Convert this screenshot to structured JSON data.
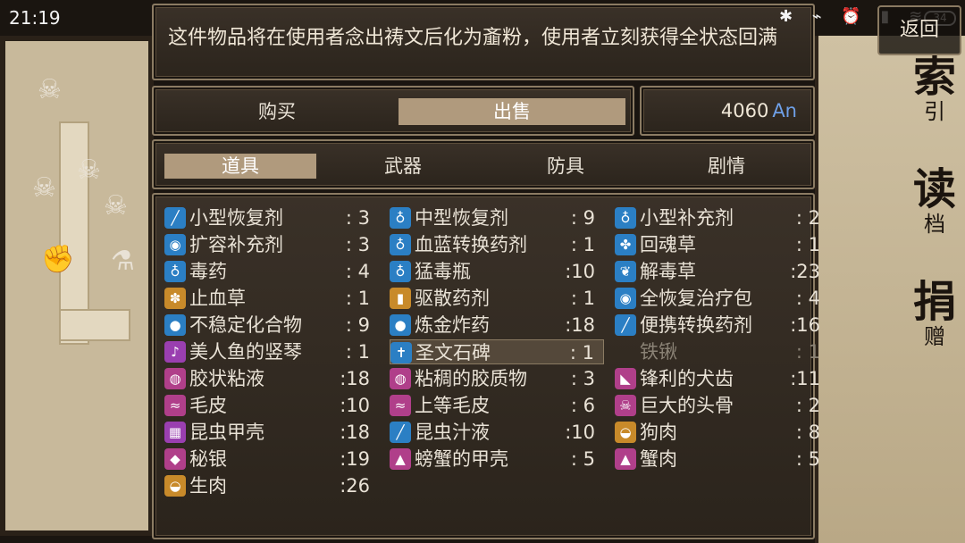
{
  "status_bar": {
    "time": "21:19",
    "icons": "✱ ⌁ ⏰ ▮ ≋",
    "battery": "34"
  },
  "back_label": "返回",
  "side_menu": [
    {
      "big": "索",
      "small": "引"
    },
    {
      "big": "读",
      "small": "档"
    },
    {
      "big": "捐",
      "small": "赠"
    }
  ],
  "description": "这件物品将在使用者念出祷文后化为齑粉，使用者立刻获得全状态回满",
  "mode": {
    "buy": "购买",
    "sell": "出售",
    "active": "sell"
  },
  "money": {
    "value": "4060",
    "unit": "An"
  },
  "tabs": [
    "道具",
    "武器",
    "防具",
    "剧情"
  ],
  "active_tab": 0,
  "colors": {
    "accent": "#b09a7d",
    "frame_border": "#8b7b63",
    "currency": "#6fa0e8"
  },
  "items": [
    [
      {
        "name": "小型恢复剂",
        "qty": ": 3",
        "icon": "syringe-icon",
        "glyph": "╱",
        "color": "#2b7fc4"
      },
      {
        "name": "扩容补充剂",
        "qty": ": 3",
        "icon": "pot-icon",
        "glyph": "◉",
        "color": "#2b7fc4"
      },
      {
        "name": "毒药",
        "qty": ": 4",
        "icon": "bag-icon",
        "glyph": "♁",
        "color": "#2b7fc4"
      },
      {
        "name": "止血草",
        "qty": ": 1",
        "icon": "herb-icon",
        "glyph": "✽",
        "color": "#c88a2a"
      },
      {
        "name": "不稳定化合物",
        "qty": ": 9",
        "icon": "bomb-icon",
        "glyph": "●",
        "color": "#2b7fc4"
      },
      {
        "name": "美人鱼的竖琴",
        "qty": ": 1",
        "icon": "harp-icon",
        "glyph": "♪",
        "color": "#9a3fb0"
      },
      {
        "name": "胶状粘液",
        "qty": ":18",
        "icon": "slime-icon",
        "glyph": "◍",
        "color": "#b03f8a"
      },
      {
        "name": "毛皮",
        "qty": ":10",
        "icon": "fur-icon",
        "glyph": "≈",
        "color": "#b03f8a"
      },
      {
        "name": "昆虫甲壳",
        "qty": ":18",
        "icon": "shell-icon",
        "glyph": "▦",
        "color": "#9a3fb0"
      },
      {
        "name": "秘银",
        "qty": ":19",
        "icon": "ore-icon",
        "glyph": "◆",
        "color": "#b03f8a"
      },
      {
        "name": "生肉",
        "qty": ":26",
        "icon": "meat-icon",
        "glyph": "◒",
        "color": "#c88a2a"
      }
    ],
    [
      {
        "name": "中型恢复剂",
        "qty": ": 9",
        "icon": "flask-icon",
        "glyph": "♁",
        "color": "#2b7fc4"
      },
      {
        "name": "血蓝转换药剂",
        "qty": ": 1",
        "icon": "bag-icon",
        "glyph": "♁",
        "color": "#2b7fc4"
      },
      {
        "name": "猛毒瓶",
        "qty": ":10",
        "icon": "bag-icon",
        "glyph": "♁",
        "color": "#2b7fc4"
      },
      {
        "name": "驱散药剂",
        "qty": ": 1",
        "icon": "vial-icon",
        "glyph": "▮",
        "color": "#c88a2a"
      },
      {
        "name": "炼金炸药",
        "qty": ":18",
        "icon": "bomb-icon",
        "glyph": "●",
        "color": "#2b7fc4"
      },
      {
        "name": "圣文石碑",
        "qty": ": 1",
        "icon": "cross-icon",
        "glyph": "✝",
        "color": "#2b7fc4",
        "selected": true
      },
      {
        "name": "粘稠的胶质物",
        "qty": ": 3",
        "icon": "slime-icon",
        "glyph": "◍",
        "color": "#b03f8a"
      },
      {
        "name": "上等毛皮",
        "qty": ": 6",
        "icon": "fur-icon",
        "glyph": "≈",
        "color": "#b03f8a"
      },
      {
        "name": "昆虫汁液",
        "qty": ":10",
        "icon": "syringe-icon",
        "glyph": "╱",
        "color": "#2b7fc4"
      },
      {
        "name": "螃蟹的甲壳",
        "qty": ": 5",
        "icon": "crab-shell-icon",
        "glyph": "▲",
        "color": "#b03f8a"
      }
    ],
    [
      {
        "name": "小型补充剂",
        "qty": ": 2",
        "icon": "flask-icon",
        "glyph": "♁",
        "color": "#2b7fc4"
      },
      {
        "name": "回魂草",
        "qty": ": 1",
        "icon": "clover-icon",
        "glyph": "✤",
        "color": "#2b7fc4"
      },
      {
        "name": "解毒草",
        "qty": ":23",
        "icon": "leaf-icon",
        "glyph": "❦",
        "color": "#2b7fc4"
      },
      {
        "name": "全恢复治疗包",
        "qty": ": 4",
        "icon": "kit-icon",
        "glyph": "◉",
        "color": "#2b7fc4"
      },
      {
        "name": "便携转换药剂",
        "qty": ":16",
        "icon": "syringe-icon",
        "glyph": "╱",
        "color": "#2b7fc4"
      },
      {
        "name": "铁锹",
        "qty": ": 1",
        "icon": "",
        "glyph": "",
        "color": "transparent",
        "dim": true
      },
      {
        "name": "锋利的犬齿",
        "qty": ":11",
        "icon": "fang-icon",
        "glyph": "◣",
        "color": "#b03f8a"
      },
      {
        "name": "巨大的头骨",
        "qty": ": 2",
        "icon": "skull-icon",
        "glyph": "☠",
        "color": "#b03f8a"
      },
      {
        "name": "狗肉",
        "qty": ": 8",
        "icon": "meat-icon",
        "glyph": "◒",
        "color": "#c88a2a"
      },
      {
        "name": "蟹肉",
        "qty": ": 5",
        "icon": "crab-meat-icon",
        "glyph": "▲",
        "color": "#b03f8a"
      }
    ]
  ]
}
